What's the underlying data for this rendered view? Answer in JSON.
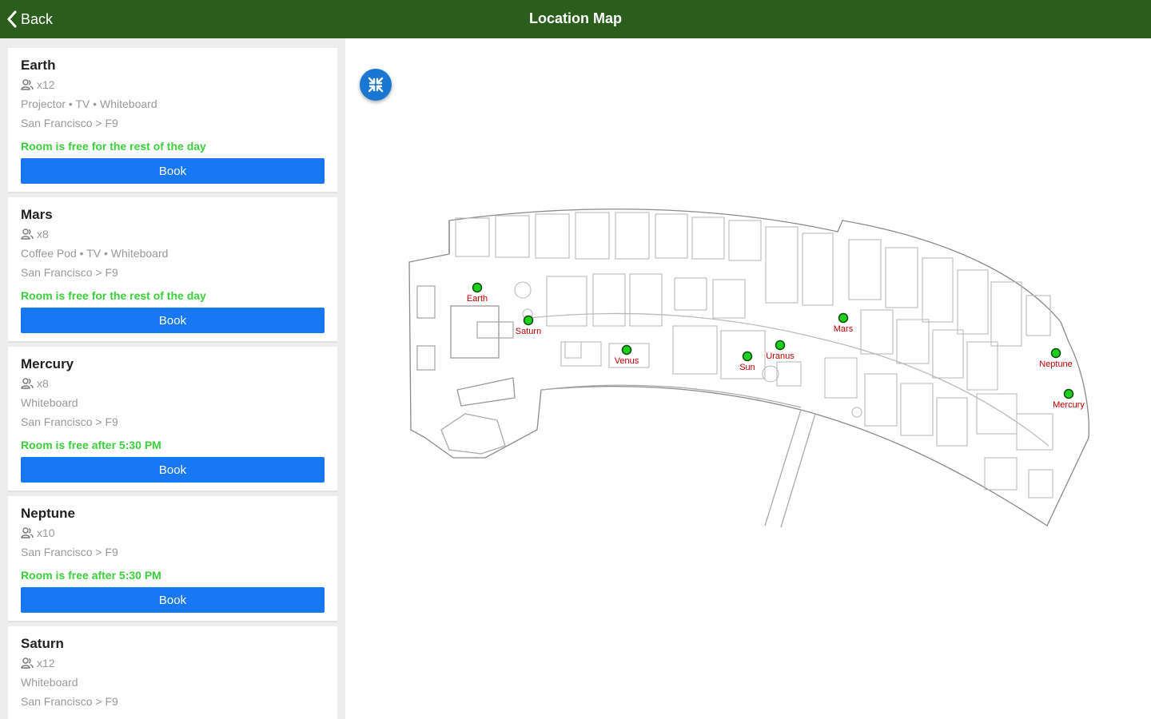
{
  "header": {
    "back_label": "Back",
    "title": "Location Map"
  },
  "rooms": [
    {
      "name": "Earth",
      "capacity": "x12",
      "amenities": "Projector • TV • Whiteboard",
      "location": "San Francisco > F9",
      "status": "Room is free for the rest of the day",
      "book_label": "Book"
    },
    {
      "name": "Mars",
      "capacity": "x8",
      "amenities": "Coffee Pod • TV • Whiteboard",
      "location": "San Francisco > F9",
      "status": "Room is free for the rest of the day",
      "book_label": "Book"
    },
    {
      "name": "Mercury",
      "capacity": "x8",
      "amenities": "Whiteboard",
      "location": "San Francisco > F9",
      "status": "Room is free after 5:30 PM",
      "book_label": "Book"
    },
    {
      "name": "Neptune",
      "capacity": "x10",
      "location": "San Francisco > F9",
      "status": "Room is free after 5:30 PM",
      "book_label": "Book"
    },
    {
      "name": "Saturn",
      "capacity": "x12",
      "amenities": "Whiteboard",
      "location": "San Francisco > F9"
    }
  ],
  "map": {
    "fullscreen_icon": "collapse-arrows-icon",
    "pins": [
      {
        "label": "Earth"
      },
      {
        "label": "Saturn"
      },
      {
        "label": "Venus"
      },
      {
        "label": "Sun"
      },
      {
        "label": "Uranus"
      },
      {
        "label": "Mars"
      },
      {
        "label": "Neptune"
      },
      {
        "label": "Mercury"
      }
    ]
  },
  "colors": {
    "header": "#2b5e1c",
    "book_button": "#1877f2",
    "status_free": "#3ccf3c",
    "pin": "#1fcf1f",
    "pin_label": "#c00000",
    "fullscreen_button": "#1976d2"
  }
}
